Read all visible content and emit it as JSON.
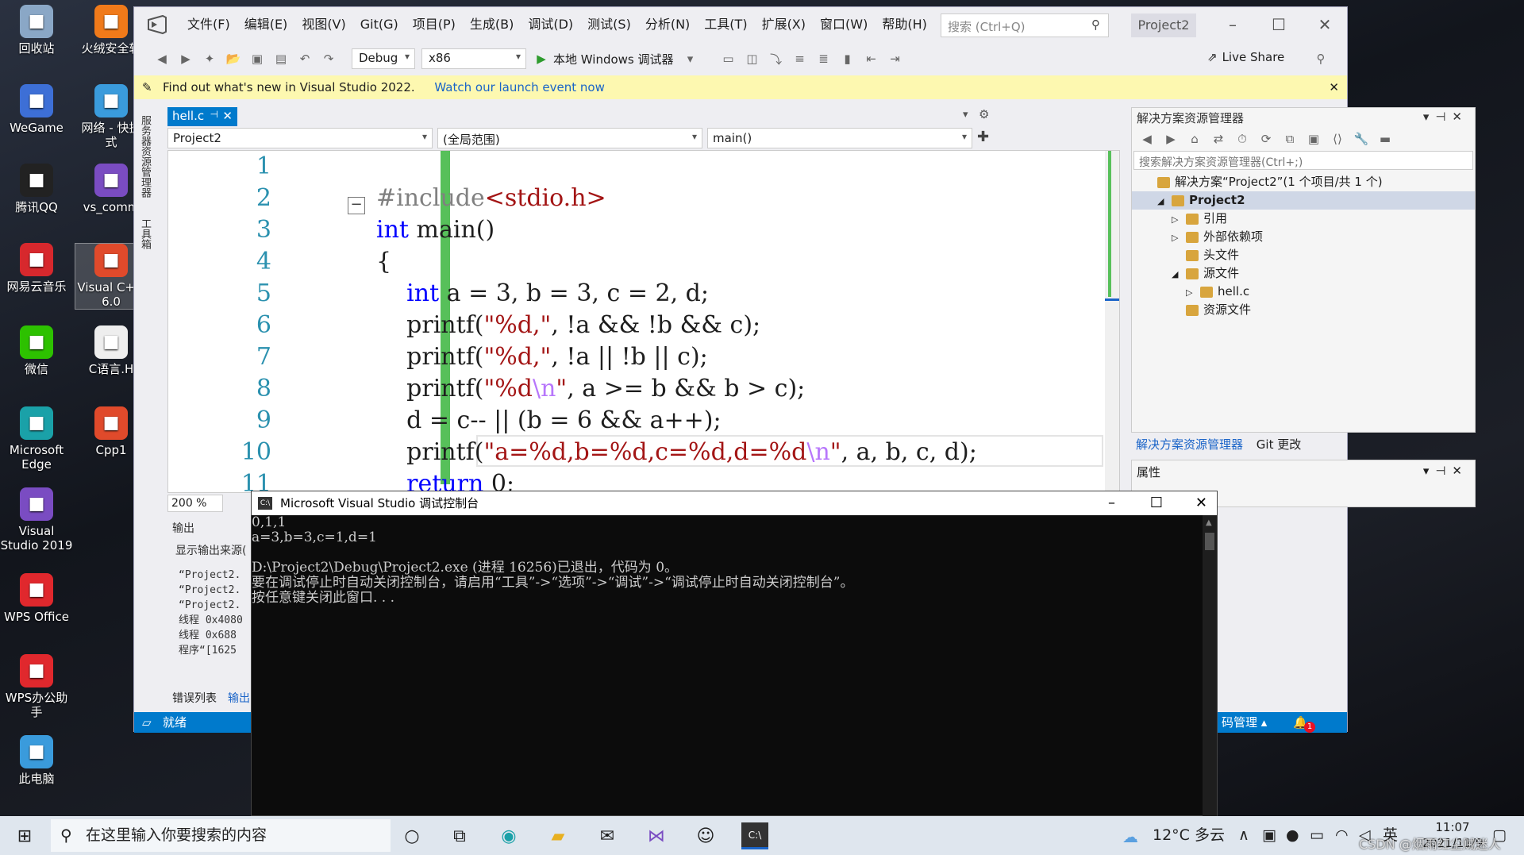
{
  "desktop": {
    "icons": [
      {
        "label": "回收站",
        "icon": "recycle-bin-icon",
        "color": "#8aa7c6"
      },
      {
        "label": "火绒安全软",
        "icon": "huorong-icon",
        "color": "#f07a1a"
      },
      {
        "label": "WeGame",
        "icon": "wegame-icon",
        "color": "#3d6fd6"
      },
      {
        "label": "网络 - 快捷\n式",
        "icon": "network-icon",
        "color": "#3a9bdc"
      },
      {
        "label": "腾讯QQ",
        "icon": "qq-icon",
        "color": "#222222"
      },
      {
        "label": "vs_comm",
        "icon": "vs-installer-icon",
        "color": "#7a4cc2"
      },
      {
        "label": "网易云音乐",
        "icon": "netease-music-icon",
        "color": "#d7282d"
      },
      {
        "label": "Visual C++\n6.0",
        "icon": "visual-cpp-icon",
        "color": "#e04a2b"
      },
      {
        "label": "微信",
        "icon": "wechat-icon",
        "color": "#2dc100"
      },
      {
        "label": "C语言.H",
        "icon": "c-file-icon",
        "color": "#eeeeee"
      },
      {
        "label": "Microsoft\nEdge",
        "icon": "edge-icon",
        "color": "#1aa1a8"
      },
      {
        "label": "Cpp1",
        "icon": "cpp-file-icon",
        "color": "#e04a2b"
      },
      {
        "label": "Visual\nStudio 2019",
        "icon": "visual-studio-icon",
        "color": "#7a4cc2"
      },
      {
        "label": "WPS Office",
        "icon": "wps-icon",
        "color": "#e0282d"
      },
      {
        "label": "WPS办公助\n手",
        "icon": "wps-assistant-icon",
        "color": "#e0282d"
      },
      {
        "label": "此电脑",
        "icon": "this-pc-icon",
        "color": "#3a9bdc"
      }
    ]
  },
  "vs": {
    "menu": [
      "文件(F)",
      "编辑(E)",
      "视图(V)",
      "Git(G)",
      "项目(P)",
      "生成(B)",
      "调试(D)",
      "测试(S)",
      "分析(N)",
      "工具(T)",
      "扩展(X)",
      "窗口(W)",
      "帮助(H)"
    ],
    "search_placeholder": "搜索 (Ctrl+Q)",
    "project_badge": "Project2",
    "config": "Debug",
    "platform": "x86",
    "run_label": "本地 Windows 调试器",
    "live_share": "Live Share",
    "info_text": "Find out what's new in Visual Studio 2022.",
    "info_link": "Watch our launch event now",
    "side_tabs": [
      "服务器资源管理器",
      "工具箱"
    ],
    "doc_tab": "hell.c",
    "nav_project": "Project2",
    "nav_scope": "(全局范围)",
    "nav_func": "main()",
    "zoom": "200 %",
    "code_line_numbers": [
      "1",
      "2",
      "3",
      "4",
      "5",
      "6",
      "7",
      "8",
      "9",
      "10",
      "11"
    ],
    "output_title": "输出",
    "output_source": "显示输出来源(",
    "output_lines": [
      "“Project2.",
      "“Project2.",
      "“Project2.",
      "线程 0x4080",
      "线程 0x688 ",
      "程序“[1625"
    ],
    "bottom_tabs": [
      "错误列表",
      "输出"
    ],
    "status": "就绪",
    "status_right": "码管理 ▴",
    "notification_count": "1"
  },
  "solution_explorer": {
    "title": "解决方案资源管理器",
    "search_placeholder": "搜索解决方案资源管理器(Ctrl+;)",
    "tree": [
      {
        "label": "解决方案“Project2”(1 个项目/共 1 个)",
        "indent": 0,
        "arrow": ""
      },
      {
        "label": "Project2",
        "indent": 1,
        "arrow": "◢",
        "selected": true
      },
      {
        "label": "引用",
        "indent": 2,
        "arrow": "▷"
      },
      {
        "label": "外部依赖项",
        "indent": 2,
        "arrow": "▷"
      },
      {
        "label": "头文件",
        "indent": 2,
        "arrow": ""
      },
      {
        "label": "源文件",
        "indent": 2,
        "arrow": "◢"
      },
      {
        "label": "hell.c",
        "indent": 3,
        "arrow": "▷"
      },
      {
        "label": "资源文件",
        "indent": 2,
        "arrow": ""
      }
    ],
    "tabs": [
      "解决方案资源管理器",
      "Git 更改"
    ],
    "props_title": "属性"
  },
  "console": {
    "title": "Microsoft Visual Studio 调试控制台",
    "lines": [
      "0,1,1",
      "a=3,b=3,c=1,d=1",
      "",
      "D:\\Project2\\Debug\\Project2.exe (进程 16256)已退出，代码为 0。",
      "要在调试停止时自动关闭控制台，请启用“工具”->“选项”->“调试”->“调试停止时自动关闭控制台”。",
      "按任意键关闭此窗口. . ."
    ]
  },
  "taskbar": {
    "search_placeholder": "在这里输入你要搜索的内容",
    "weather": "12°C 多云",
    "ime": "英",
    "time": "11:07",
    "date": "2021/11/9",
    "watermark": "CSDN @烟雨红尘贼迷人"
  }
}
